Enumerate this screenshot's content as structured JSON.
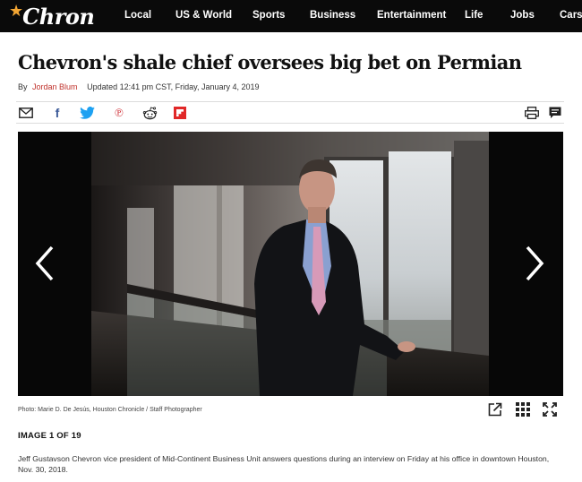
{
  "site": {
    "logo_text": "Chron",
    "nav": [
      "Local",
      "US & World",
      "Sports",
      "Business",
      "Entertainment",
      "Life",
      "Jobs",
      "Cars"
    ]
  },
  "article": {
    "headline": "Chevron's shale chief oversees big bet on Permian",
    "byline_prefix": "By",
    "author": "Jordan Blum",
    "updated": "Updated 12:41 pm CST, Friday, January 4, 2019"
  },
  "share": {
    "icons": [
      "mail-icon",
      "facebook-icon",
      "twitter-icon",
      "pinterest-icon",
      "reddit-icon",
      "flipboard-icon",
      "print-icon",
      "comment-icon"
    ]
  },
  "gallery": {
    "credit": "Photo: Marie D. De Jesús, Houston Chronicle / Staff Photographer",
    "counter": "IMAGE 1 OF 19",
    "caption": "Jeff Gustavson Chevron vice president of Mid-Continent Business Unit answers questions during an interview on Friday at his office in downtown Houston, Nov. 30, 2018."
  },
  "colors": {
    "nav_bg": "#0a0a0a",
    "logo_star": "#f2a533",
    "author_link": "#c0312b",
    "flipboard": "#e12828",
    "twitter": "#1da1f2",
    "facebook": "#3b5998",
    "pinterest": "#cb2027"
  }
}
